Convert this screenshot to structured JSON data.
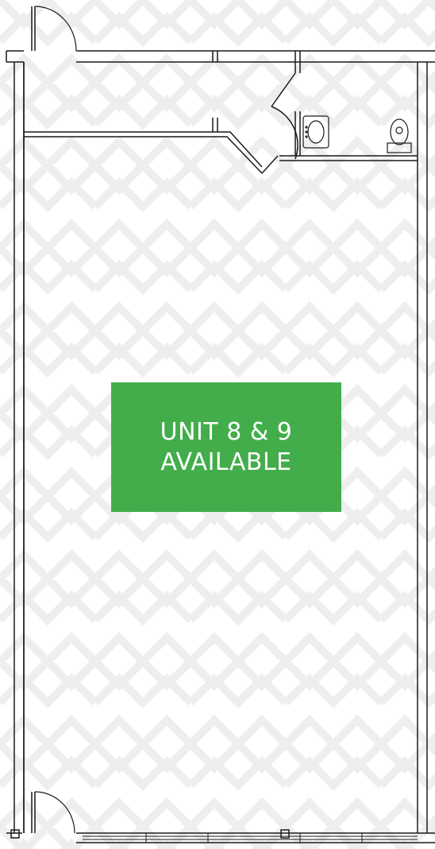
{
  "colors": {
    "wall": "#1a1a1a",
    "label_fill": "#43ad4b",
    "label_text": "#ffffff",
    "pattern": "#e9e9e9"
  },
  "unit_label": {
    "line1": "UNIT 8 & 9",
    "line2": "AVAILABLE"
  },
  "fixtures": [
    "sink-icon",
    "toilet-icon"
  ]
}
